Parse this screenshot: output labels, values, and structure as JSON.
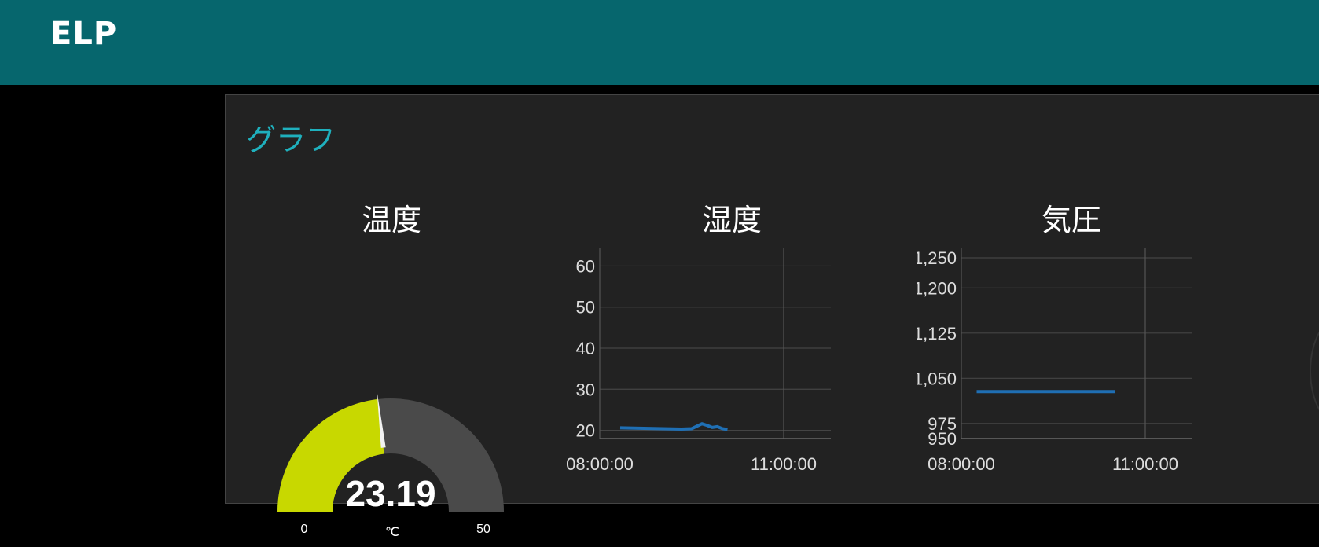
{
  "header": {
    "title": "ELP",
    "bg_color": "#06666d"
  },
  "group": {
    "title": "グラフ",
    "title_color": "#1fb0bd"
  },
  "gauge": {
    "title": "温度",
    "value_text": "23.19",
    "value": 23.19,
    "min": 0,
    "max": 50,
    "min_label": "0",
    "max_label": "50",
    "unit": "℃",
    "fill_color": "#c8d800",
    "track_color": "#4a4a4a"
  },
  "chart_data": [
    {
      "type": "line",
      "title": "湿度",
      "ylim": [
        18,
        62
      ],
      "yticks": [
        20,
        30,
        40,
        50,
        60
      ],
      "ytick_labels": [
        "20",
        "30",
        "40",
        "50",
        "60"
      ],
      "xticks": [
        "08:00:00",
        "11:00:00"
      ],
      "grid": true,
      "line_color": "#1f6fb4",
      "series": [
        {
          "x": [
            "08:20",
            "09:20",
            "09:30",
            "09:40",
            "09:45",
            "09:50",
            "09:55",
            "10:00",
            "10:05"
          ],
          "y": [
            20.6,
            20.3,
            20.4,
            21.6,
            21.2,
            20.7,
            20.9,
            20.4,
            20.2
          ]
        }
      ]
    },
    {
      "type": "line",
      "title": "気圧",
      "ylim": [
        950,
        1250
      ],
      "yticks": [
        950,
        975,
        1050,
        1125,
        1200,
        1250
      ],
      "ytick_labels": [
        "950",
        "975",
        "1,050",
        "1,125",
        "1,200",
        "1,250"
      ],
      "xticks": [
        "08:00:00",
        "11:00:00"
      ],
      "grid": true,
      "line_color": "#1f6fb4",
      "series": [
        {
          "x": [
            "08:15",
            "10:30"
          ],
          "y": [
            1028,
            1028
          ]
        }
      ]
    }
  ]
}
